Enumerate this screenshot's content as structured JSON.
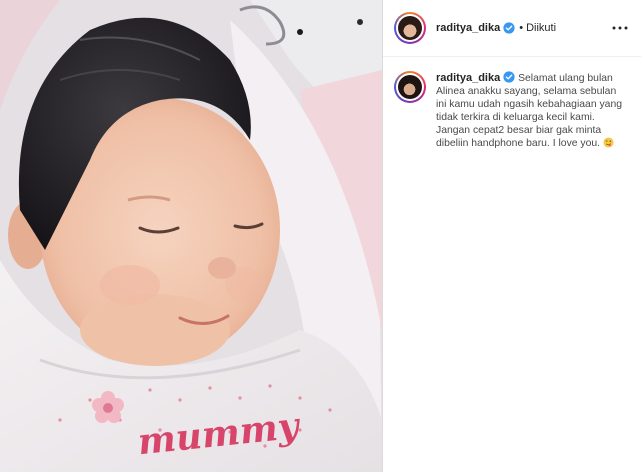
{
  "post": {
    "username": "raditya_dika",
    "follow_status": "Diikuti",
    "separator": "•",
    "caption": "Selamat ulang bulan Alinea anakku sayang, selama sebulan ini kamu udah ngasih kebahagiaan yang tidak terkira di keluarga kecil kami. Jangan cepat2 besar biar gak minta dibeliin handphone baru. I love you.",
    "caption_emoji": "winking-face-with-tongue-icon",
    "onesie_text": "mummy"
  },
  "colors": {
    "verified": "#3897f0",
    "border": "#dbdbdb",
    "text": "#262626"
  }
}
